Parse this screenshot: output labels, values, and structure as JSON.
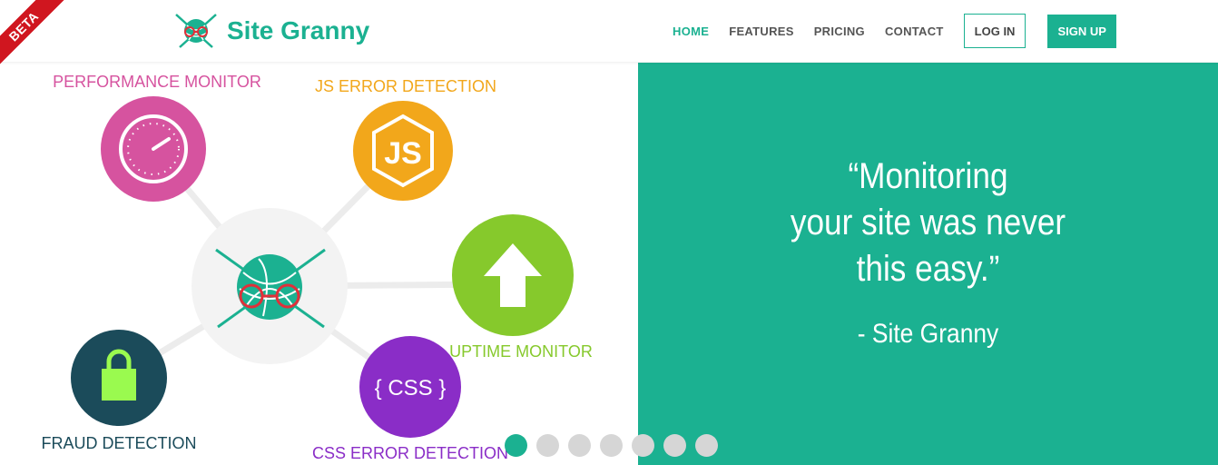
{
  "badge": {
    "label": "BETA"
  },
  "brand": {
    "name": "Site Granny"
  },
  "nav": {
    "items": [
      {
        "label": "HOME",
        "active": true
      },
      {
        "label": "FEATURES",
        "active": false
      },
      {
        "label": "PRICING",
        "active": false
      },
      {
        "label": "CONTACT",
        "active": false
      }
    ],
    "login_label": "LOG IN",
    "signup_label": "SIGN UP"
  },
  "features": {
    "performance": "PERFORMANCE MONITOR",
    "js": "JS ERROR DETECTION",
    "uptime": "UPTIME MONITOR",
    "fraud": "FRAUD DETECTION",
    "css": "CSS ERROR DETECTION",
    "js_icon_text": "JS",
    "css_icon_text": "{ CSS }"
  },
  "hero": {
    "quote_lines": [
      "“Monitoring",
      "your site was never",
      "this easy.”"
    ],
    "author": "- Site Granny"
  },
  "slider": {
    "count": 7,
    "active_index": 0
  },
  "colors": {
    "brand": "#1bb191",
    "performance": "#d6539f",
    "js": "#f2a71b",
    "uptime": "#86c92c",
    "fraud": "#1b4b5a",
    "css": "#8a2dc7",
    "beta": "#d0161f"
  }
}
